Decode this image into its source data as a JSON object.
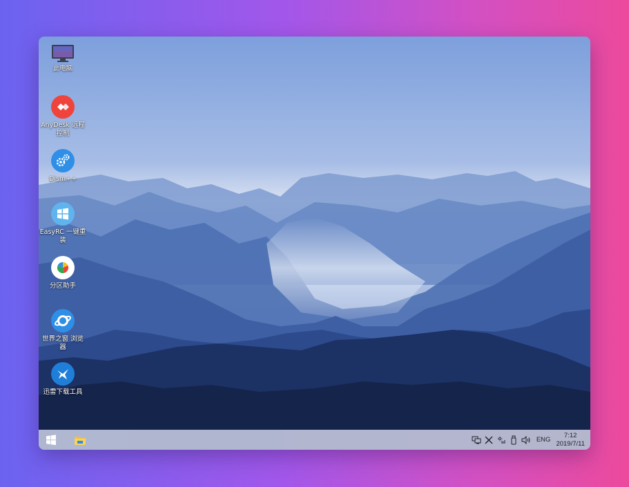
{
  "desktop": {
    "icons": [
      {
        "id": "this-pc",
        "label": "此电脑",
        "icon": "monitor-icon"
      },
      {
        "id": "anydesk",
        "label": "AnyDesk 远程控制",
        "icon": "anydesk-icon"
      },
      {
        "id": "dism",
        "label": "Dism++",
        "icon": "gears-icon"
      },
      {
        "id": "easyrc",
        "label": "EasyRC 一键重装",
        "icon": "windows-logo-icon"
      },
      {
        "id": "partition",
        "label": "分区助手",
        "icon": "pie-chart-icon"
      },
      {
        "id": "theworld",
        "label": "世界之窗 浏览器",
        "icon": "browser-globe-icon"
      },
      {
        "id": "xunlei",
        "label": "迅雷下载工具",
        "icon": "bird-icon"
      }
    ]
  },
  "taskbar": {
    "start_icon": "windows-start-icon",
    "pinned": [
      {
        "name": "file-explorer",
        "icon": "folder-icon"
      }
    ],
    "tray": {
      "icons": [
        "network-icon",
        "x-icon",
        "brightness-icon",
        "usb-icon",
        "volume-icon"
      ],
      "language": "ENG",
      "time": "7:12",
      "date": "2019/7/11"
    }
  },
  "colors": {
    "taskbar": "#b2bace",
    "anydesk": "#ef443b",
    "accent_blue": "#2f8ee6"
  }
}
